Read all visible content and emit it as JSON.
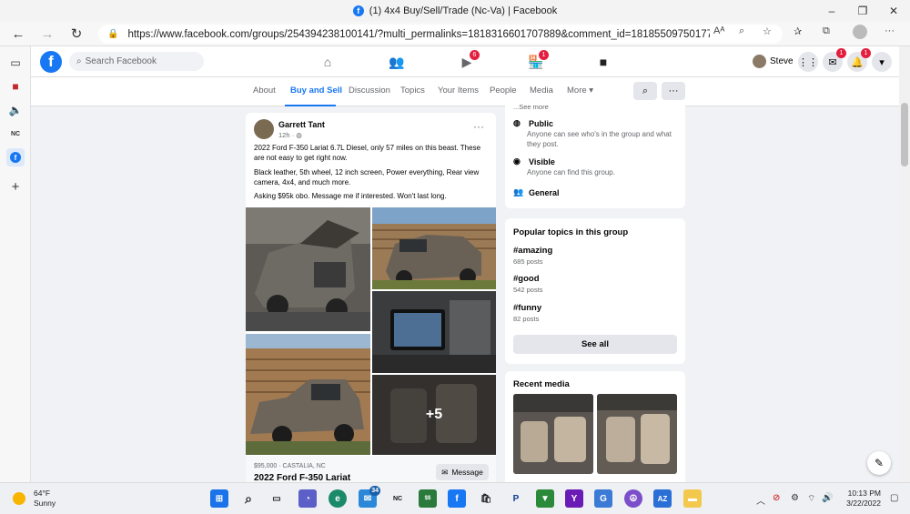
{
  "browser": {
    "tab_title": "(1) 4x4 Buy/Sell/Trade (Nc-Va) | Facebook",
    "url": "https://www.facebook.com/groups/254394238100141/?multi_permalinks=1818316601707889&comment_id=1818550975017785&notif_i...",
    "minimize": "–",
    "maximize": "❐",
    "close": "✕"
  },
  "facebook": {
    "search_placeholder": "Search Facebook",
    "profile_name": "Steve",
    "badges": {
      "watch": "6",
      "marketplace": "1",
      "messenger": "1",
      "notifications": "1"
    }
  },
  "group_tabs": [
    {
      "label": "About"
    },
    {
      "label": "Buy and Sell"
    },
    {
      "label": "Discussion"
    },
    {
      "label": "Topics"
    },
    {
      "label": "Your Items"
    },
    {
      "label": "People"
    },
    {
      "label": "Media"
    },
    {
      "label": "More ▾"
    }
  ],
  "post": {
    "author": "Garrett Tant",
    "meta": "12h · ",
    "text1": "2022 Ford F-350 Lariat 6.7L Diesel, only 57 miles on this beast. These are not easy to get right now.",
    "text2": "Black leather, 5th wheel, 12 inch screen, Power everything, Rear view camera, 4x4, and much more.",
    "text3": "Asking $95k obo. Message me if interested. Won't last long.",
    "more_photos": "+5",
    "listing_price": "$95,000 · CASTALIA, NC",
    "listing_title": "2022 Ford F-350 Lariat",
    "message_label": "Message"
  },
  "about": {
    "clipped": "...See more",
    "public_title": "Public",
    "public_desc": "Anyone can see who's in the group and what they post.",
    "visible_title": "Visible",
    "visible_desc": "Anyone can find this group.",
    "general_title": "General"
  },
  "popular": {
    "title": "Popular topics in this group",
    "topics": [
      {
        "name": "#amazing",
        "count": "685 posts"
      },
      {
        "name": "#good",
        "count": "542 posts"
      },
      {
        "name": "#funny",
        "count": "82 posts"
      }
    ],
    "see_all": "See all"
  },
  "recent_media": {
    "title": "Recent media"
  },
  "taskbar": {
    "temp": "64°F",
    "condition": "Sunny",
    "badge": "34",
    "time": "10:13 PM",
    "date": "3/22/2022"
  }
}
